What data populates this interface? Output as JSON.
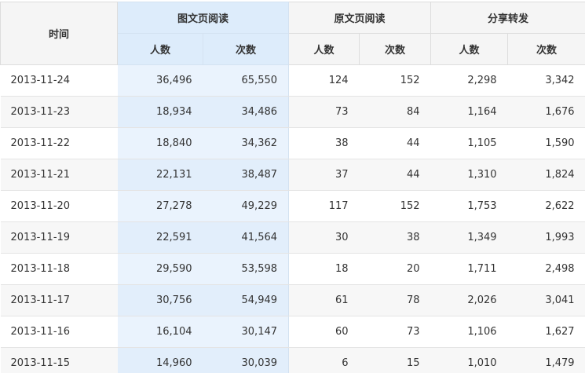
{
  "header": {
    "time": "时间",
    "groups": [
      "图文页阅读",
      "原文页阅读",
      "分享转发"
    ],
    "sub": [
      "人数",
      "次数",
      "人数",
      "次数",
      "人数",
      "次数"
    ]
  },
  "rows": [
    {
      "date": "2013-11-24",
      "v": [
        "36,496",
        "65,550",
        "124",
        "152",
        "2,298",
        "3,342"
      ]
    },
    {
      "date": "2013-11-23",
      "v": [
        "18,934",
        "34,486",
        "73",
        "84",
        "1,164",
        "1,676"
      ]
    },
    {
      "date": "2013-11-22",
      "v": [
        "18,840",
        "34,362",
        "38",
        "44",
        "1,105",
        "1,590"
      ]
    },
    {
      "date": "2013-11-21",
      "v": [
        "22,131",
        "38,487",
        "37",
        "44",
        "1,310",
        "1,824"
      ]
    },
    {
      "date": "2013-11-20",
      "v": [
        "27,278",
        "49,229",
        "117",
        "152",
        "1,753",
        "2,622"
      ]
    },
    {
      "date": "2013-11-19",
      "v": [
        "22,591",
        "41,564",
        "30",
        "38",
        "1,349",
        "1,993"
      ]
    },
    {
      "date": "2013-11-18",
      "v": [
        "29,590",
        "53,598",
        "18",
        "20",
        "1,711",
        "2,498"
      ]
    },
    {
      "date": "2013-11-17",
      "v": [
        "30,756",
        "54,949",
        "61",
        "78",
        "2,026",
        "3,041"
      ]
    },
    {
      "date": "2013-11-16",
      "v": [
        "16,104",
        "30,147",
        "60",
        "73",
        "1,106",
        "1,627"
      ]
    },
    {
      "date": "2013-11-15",
      "v": [
        "14,960",
        "30,039",
        "6",
        "15",
        "1,010",
        "1,479"
      ]
    }
  ],
  "colors": {
    "highlight_header": "#ddecfb",
    "highlight_cell": "#eaf3fd",
    "header_bg": "#f5f5f5",
    "row_alt": "#f7f7f7"
  }
}
